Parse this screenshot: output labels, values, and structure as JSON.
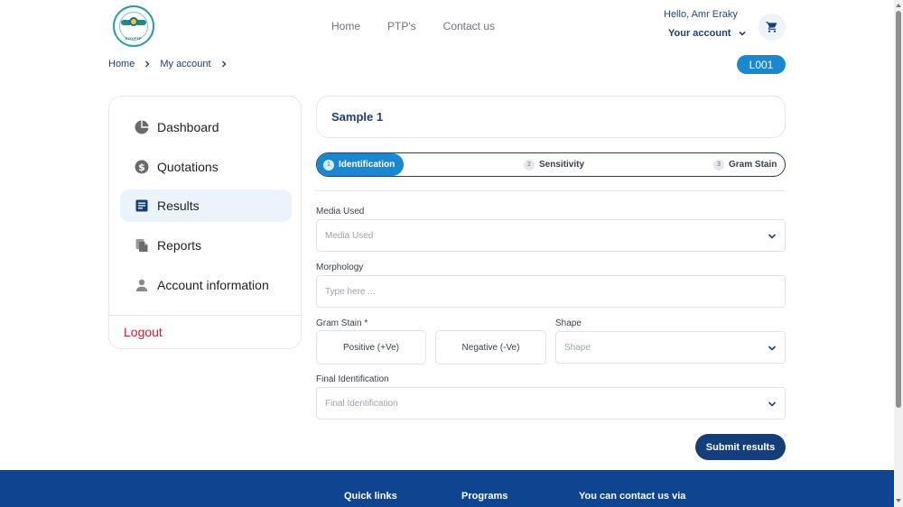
{
  "header": {
    "brand_text": "EGYPTP",
    "nav": [
      {
        "label": "Home"
      },
      {
        "label": "PTP's"
      },
      {
        "label": "Contact us"
      }
    ],
    "greeting": "Hello, Amr Eraky",
    "account_label": "Your account"
  },
  "breadcrumb": {
    "items": [
      {
        "label": "Home"
      },
      {
        "label": "My account"
      }
    ]
  },
  "code_badge": "L001",
  "sidebar": {
    "items": [
      {
        "label": "Dashboard",
        "icon": "pie-chart-icon"
      },
      {
        "label": "Quotations",
        "icon": "dollar-icon"
      },
      {
        "label": "Results",
        "icon": "document-list-icon",
        "active": true
      },
      {
        "label": "Reports",
        "icon": "files-icon"
      },
      {
        "label": "Account information",
        "icon": "person-icon"
      }
    ],
    "logout_label": "Logout"
  },
  "main": {
    "sample_title": "Sample 1",
    "steps": [
      {
        "number": "1",
        "label": "Identification",
        "active": true
      },
      {
        "number": "2",
        "label": "Sensitivity"
      },
      {
        "number": "3",
        "label": "Gram Stain"
      }
    ],
    "form": {
      "media_used": {
        "label": "Media Used",
        "placeholder": "Media Used"
      },
      "morphology": {
        "label": "Morphology",
        "placeholder": "Type here ..."
      },
      "gram_stain": {
        "label": "Gram Stain *",
        "positive": "Positive (+Ve)",
        "negative": "Negative (-Ve)"
      },
      "shape": {
        "label": "Shape",
        "placeholder": "Shape"
      },
      "final_identification": {
        "label": "Final Identification",
        "placeholder": "Final Identification"
      }
    },
    "submit_label": "Submit results"
  },
  "footer": {
    "columns": [
      {
        "label": "Quick links"
      },
      {
        "label": "Programs"
      },
      {
        "label": "You can contact us via"
      }
    ]
  },
  "colors": {
    "primary": "#1a88cf",
    "navy": "#143f7a",
    "footer": "#0f4490",
    "logout": "#c0272d",
    "active_bg": "#ecf4fb"
  }
}
